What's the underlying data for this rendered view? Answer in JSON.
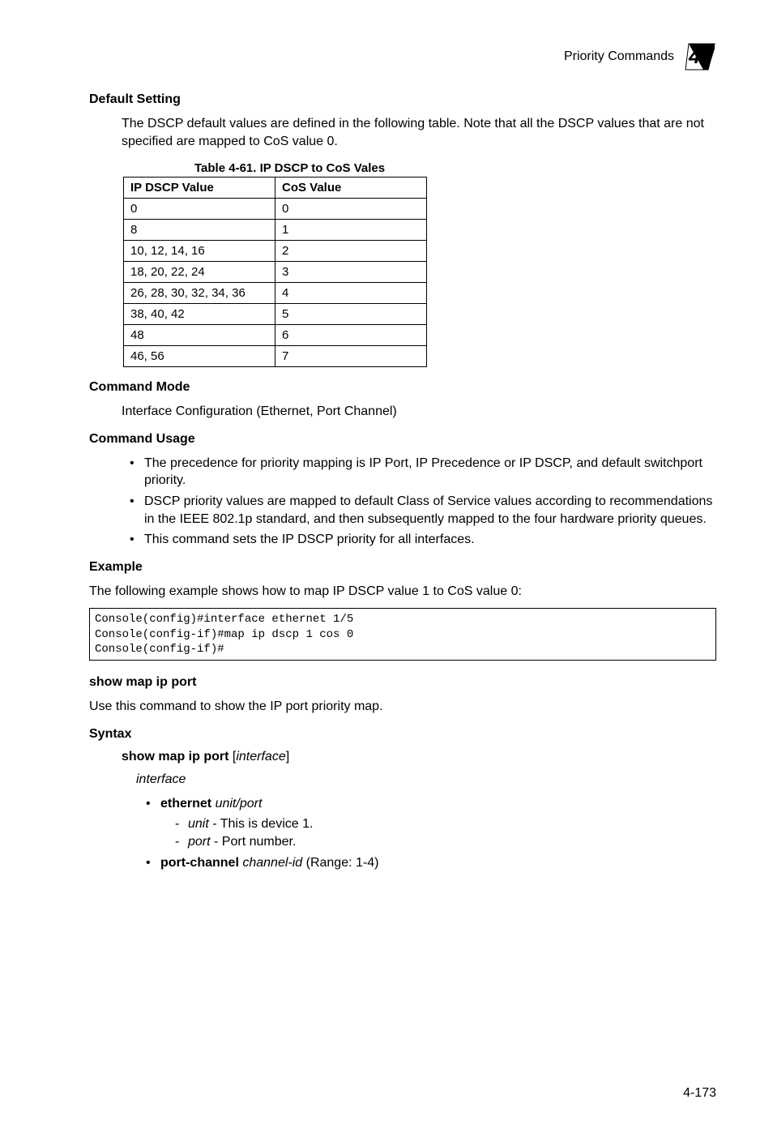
{
  "header": {
    "title": "Priority Commands",
    "chapter_number": "4"
  },
  "sections": {
    "default_setting": {
      "heading": "Default Setting",
      "body": "The DSCP default values are defined in the following table. Note that all the DSCP values that are not specified are mapped to CoS value 0."
    },
    "table": {
      "caption": "Table 4-61.  IP DSCP to CoS Vales",
      "headers": [
        "IP DSCP Value",
        "CoS Value"
      ],
      "rows": [
        [
          "0",
          "0"
        ],
        [
          "8",
          "1"
        ],
        [
          "10, 12, 14, 16",
          "2"
        ],
        [
          "18, 20, 22, 24",
          "3"
        ],
        [
          "26, 28, 30, 32, 34, 36",
          "4"
        ],
        [
          "38, 40, 42",
          "5"
        ],
        [
          "48",
          "6"
        ],
        [
          "46, 56",
          "7"
        ]
      ]
    },
    "command_mode": {
      "heading": "Command Mode",
      "body": "Interface Configuration (Ethernet, Port Channel)"
    },
    "command_usage": {
      "heading": "Command Usage",
      "items": [
        "The precedence for priority mapping is IP Port, IP Precedence or IP DSCP, and default switchport priority.",
        "DSCP priority values are mapped to default Class of Service values according to recommendations in the IEEE 802.1p standard, and then subsequently mapped to the four hardware priority queues.",
        "This command sets the IP DSCP priority for all interfaces."
      ]
    },
    "example": {
      "heading": "Example",
      "intro": "The following example shows how to map IP DSCP value 1 to CoS value 0:",
      "code": "Console(config)#interface ethernet 1/5\nConsole(config-if)#map ip dscp 1 cos 0\nConsole(config-if)#"
    },
    "show_cmd": {
      "heading": "show map ip port",
      "intro": "Use this command to show the IP port priority map."
    },
    "syntax": {
      "heading": "Syntax",
      "cmd_bold": "show map ip port",
      "cmd_arg": "interface",
      "interface_label": "interface",
      "ethernet_label": "ethernet",
      "ethernet_args": "unit/port",
      "unit_label": "unit",
      "unit_desc": " - This is device 1.",
      "port_label": "port",
      "port_desc": " - Port number.",
      "portchannel_label": "port-channel",
      "portchannel_arg": "channel-id",
      "portchannel_desc": " (Range: 1-4)"
    }
  },
  "page_number": "4-173",
  "chart_data": {
    "type": "table",
    "title": "Table 4-61. IP DSCP to CoS Vales",
    "columns": [
      "IP DSCP Value",
      "CoS Value"
    ],
    "rows": [
      {
        "ip_dscp_value": "0",
        "cos_value": 0
      },
      {
        "ip_dscp_value": "8",
        "cos_value": 1
      },
      {
        "ip_dscp_value": "10, 12, 14, 16",
        "cos_value": 2
      },
      {
        "ip_dscp_value": "18, 20, 22, 24",
        "cos_value": 3
      },
      {
        "ip_dscp_value": "26, 28, 30, 32, 34, 36",
        "cos_value": 4
      },
      {
        "ip_dscp_value": "38, 40, 42",
        "cos_value": 5
      },
      {
        "ip_dscp_value": "48",
        "cos_value": 6
      },
      {
        "ip_dscp_value": "46, 56",
        "cos_value": 7
      }
    ]
  }
}
